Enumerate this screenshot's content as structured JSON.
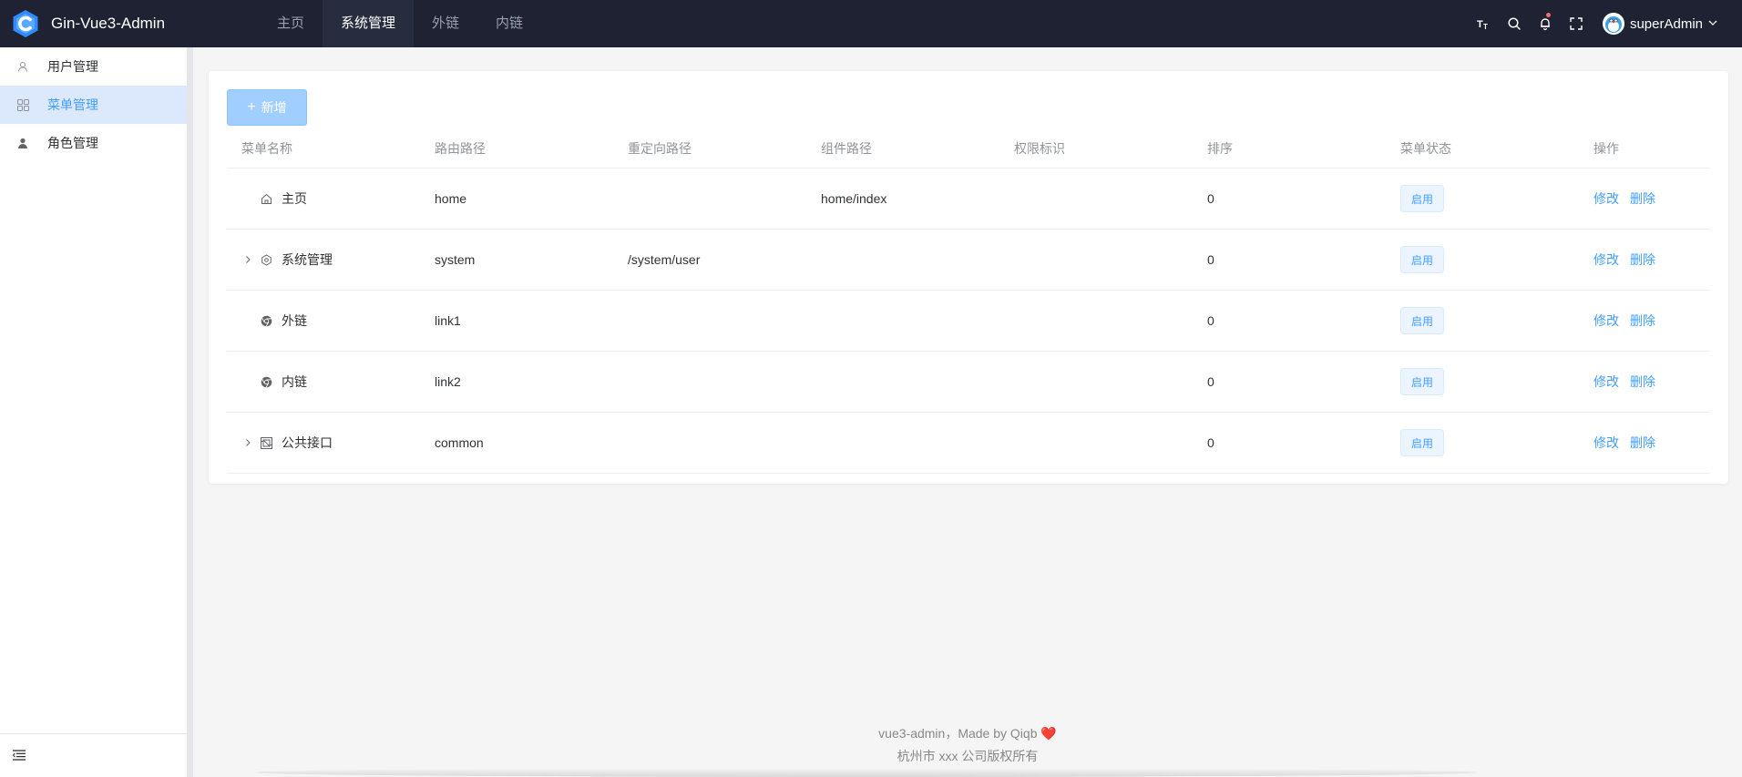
{
  "app": {
    "title": "Gin-Vue3-Admin",
    "accent": "#409eff",
    "header_bg": "#1e2232"
  },
  "topnav": {
    "items": [
      {
        "label": "主页"
      },
      {
        "label": "系统管理",
        "active": true
      },
      {
        "label": "外链"
      },
      {
        "label": "内链"
      }
    ]
  },
  "header_right": {
    "icons": [
      "text-size-icon",
      "search-icon",
      "bell-icon",
      "fullscreen-icon"
    ],
    "user_name": "superAdmin"
  },
  "sidebar": {
    "items": [
      {
        "label": "用户管理",
        "icon": "user-icon"
      },
      {
        "label": "菜单管理",
        "icon": "menu-grid-icon",
        "active": true
      },
      {
        "label": "角色管理",
        "icon": "role-icon"
      }
    ]
  },
  "toolbar": {
    "add_label": "新增"
  },
  "table": {
    "columns": [
      "菜单名称",
      "路由路径",
      "重定向路径",
      "组件路径",
      "权限标识",
      "排序",
      "菜单状态",
      "操作"
    ],
    "rows": [
      {
        "name": "主页",
        "icon": "home-icon",
        "expandable": false,
        "path": "home",
        "redirect": "",
        "component": "home/index",
        "permission": "",
        "sort": "0",
        "status": "启用"
      },
      {
        "name": "系统管理",
        "icon": "gear-icon",
        "expandable": true,
        "path": "system",
        "redirect": "/system/user",
        "component": "",
        "permission": "",
        "sort": "0",
        "status": "启用"
      },
      {
        "name": "外链",
        "icon": "chrome-icon",
        "expandable": false,
        "path": "link1",
        "redirect": "",
        "component": "",
        "permission": "",
        "sort": "0",
        "status": "启用"
      },
      {
        "name": "内链",
        "icon": "chrome-icon",
        "expandable": false,
        "path": "link2",
        "redirect": "",
        "component": "",
        "permission": "",
        "sort": "0",
        "status": "启用"
      },
      {
        "name": "公共接口",
        "icon": "api-icon",
        "expandable": true,
        "path": "common",
        "redirect": "",
        "component": "",
        "permission": "",
        "sort": "0",
        "status": "启用"
      }
    ],
    "edit_label": "修改",
    "delete_label": "删除"
  },
  "footer": {
    "line1": "vue3-admin，Made by Qiqb",
    "heart": "❤️",
    "line2": "杭州市 xxx 公司版权所有"
  }
}
